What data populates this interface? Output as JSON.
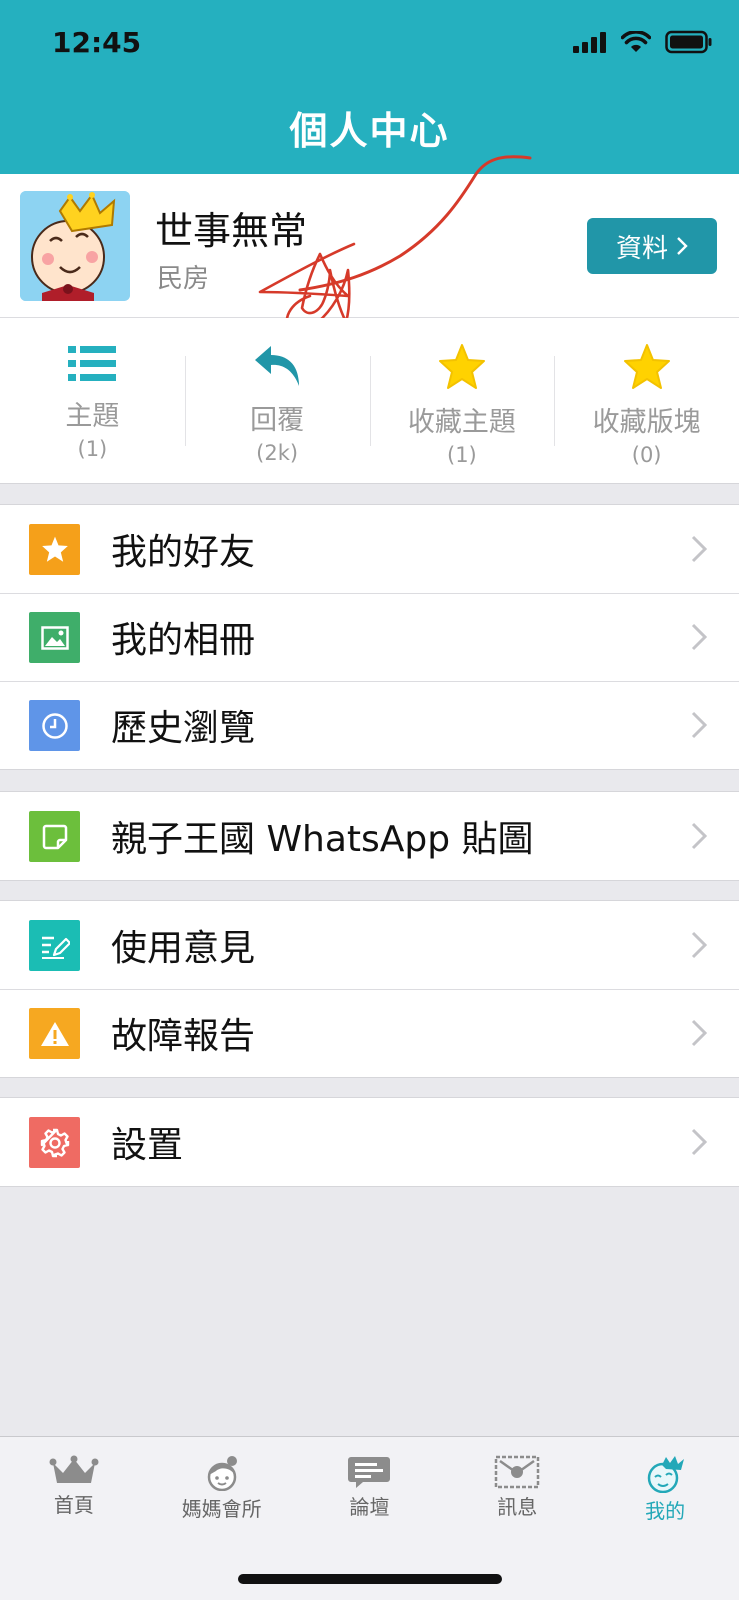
{
  "status_bar": {
    "time": "12:45"
  },
  "header": {
    "title": "個人中心"
  },
  "profile": {
    "name": "世事無常",
    "rank": "民房",
    "button_label": "資料",
    "avatar_icon": "baby-king-avatar-icon"
  },
  "stats": [
    {
      "label": "主題",
      "count": "(1)",
      "icon": "list-icon"
    },
    {
      "label": "回覆",
      "count": "(2k)",
      "icon": "reply-icon"
    },
    {
      "label": "收藏主題",
      "count": "(1)",
      "icon": "star-icon"
    },
    {
      "label": "收藏版塊",
      "count": "(0)",
      "icon": "star-icon"
    }
  ],
  "menu": {
    "friends": {
      "label": "我的好友",
      "color": "#f5a01a",
      "icon": "star-icon"
    },
    "album": {
      "label": "我的相冊",
      "color": "#3fae6a",
      "icon": "picture-icon"
    },
    "history": {
      "label": "歷史瀏覽",
      "color": "#5f95e8",
      "icon": "clock-icon"
    },
    "stickers": {
      "label": "親子王國 WhatsApp 貼圖",
      "color": "#6cbf3c",
      "icon": "sticker-icon"
    },
    "feedback": {
      "label": "使用意見",
      "color": "#1bbdb4",
      "icon": "edit-icon"
    },
    "bug_report": {
      "label": "故障報告",
      "color": "#f6a821",
      "icon": "warning-icon"
    },
    "settings": {
      "label": "設置",
      "color": "#ef6b63",
      "icon": "gear-icon"
    }
  },
  "tabbar": [
    {
      "label": "首頁",
      "icon": "crown-icon",
      "active": false
    },
    {
      "label": "媽媽會所",
      "icon": "mom-club-icon",
      "active": false
    },
    {
      "label": "論壇",
      "icon": "forum-icon",
      "active": false
    },
    {
      "label": "訊息",
      "icon": "message-icon",
      "active": false
    },
    {
      "label": "我的",
      "icon": "my-profile-icon",
      "active": true
    }
  ],
  "colors": {
    "header": "#25b0bf",
    "accent": "#23a8b8",
    "button": "#2196a8",
    "star": "#ffd200",
    "scribble": "#d63a2a"
  }
}
